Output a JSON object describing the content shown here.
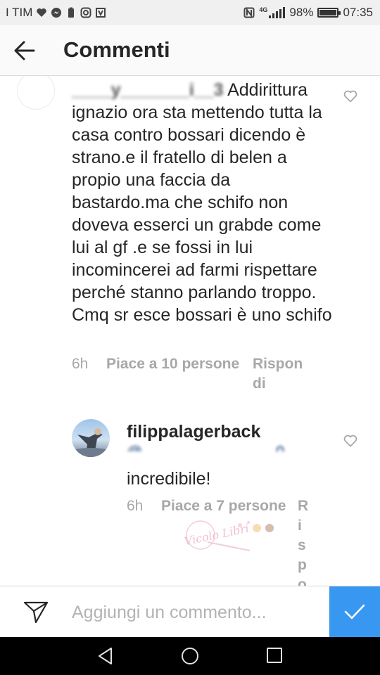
{
  "status_bar": {
    "carrier": "I TIM",
    "network": "4G",
    "battery": "98%",
    "time": "07:35"
  },
  "header": {
    "title": "Commenti",
    "back_icon": "arrow-left-icon"
  },
  "comments": [
    {
      "username_obscured": "____y_______i__3",
      "text": "Addirittura ignazio ora sta mettendo tutta la casa contro bossari dicendo è strano.e il fratello di belen a propio una faccia da bastardo.ma che schifo non doveva esserci un grabde come lui al gf .e se fossi in lui incomincerei ad farmi rispettare perché  stanno parlando  troppo. Cmq sr esce bossari è uno schifo",
      "time": "6h",
      "likes": "Piace a 10 persone",
      "reply_line1": "Rispon",
      "reply_line2": "di"
    },
    {
      "username": "filippalagerback",
      "mention_obscured": "@_______________ 0_",
      "text": "incredibile!",
      "time": "6h",
      "likes": "Piace a 7 persone",
      "reply_chars": [
        "R",
        "i",
        "s",
        "p",
        "o"
      ]
    }
  ],
  "watermark": {
    "text": "Vicolo Libri"
  },
  "input": {
    "placeholder": "Aggiungi un commento...",
    "value": ""
  },
  "colors": {
    "accent": "#3897f0",
    "text": "#262626",
    "muted": "#a8a8a8"
  }
}
